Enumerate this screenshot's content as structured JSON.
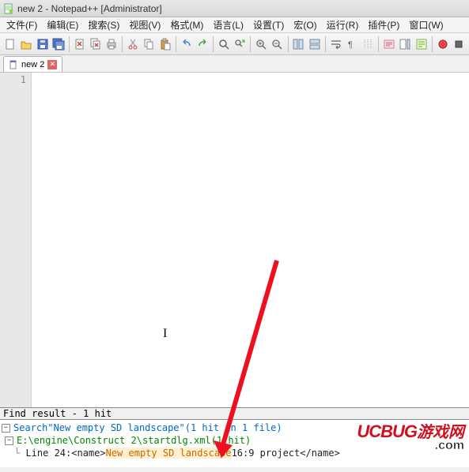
{
  "window": {
    "title": "new 2 - Notepad++ [Administrator]"
  },
  "menu": {
    "file": "文件(F)",
    "edit": "编辑(E)",
    "search": "搜索(S)",
    "view": "视图(V)",
    "format": "格式(M)",
    "language": "语言(L)",
    "settings": "设置(T)",
    "macro": "宏(O)",
    "run": "运行(R)",
    "plugins": "插件(P)",
    "window": "窗口(W)"
  },
  "tabs": [
    {
      "label": "new 2"
    }
  ],
  "editor": {
    "line1": "1"
  },
  "find": {
    "header": "Find result - 1 hit",
    "search_prefix": "Search ",
    "search_term": "\"New empty SD landscape\"",
    "search_summary": " (1 hit in 1 file)",
    "path": "E:\\engine\\Construct 2\\startdlg.xml",
    "path_summary": " (1 hit)",
    "line_label": "Line 24:",
    "line_prefix": "        <name>",
    "line_hit": "New empty SD landscape",
    "line_suffix": " 16:9 project</name>"
  },
  "watermark": {
    "brand": "UCBUG",
    "cn": "游戏网",
    "url": ".com"
  }
}
